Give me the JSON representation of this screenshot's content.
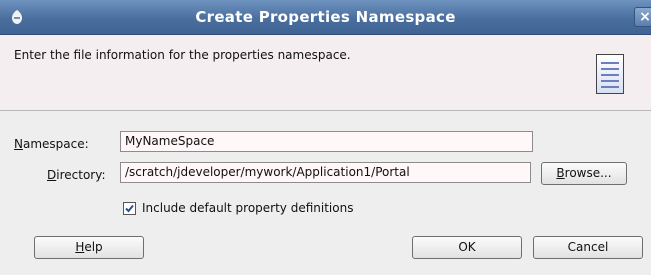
{
  "dialog": {
    "title": "Create Properties Namespace",
    "close_glyph": "×",
    "instructions": "Enter the file information for the properties namespace.",
    "header_icon": "document-icon"
  },
  "form": {
    "namespace_label_mnemonic": "N",
    "namespace_label_rest": "amespace:",
    "namespace_value": "MyNameSpace",
    "directory_label_mnemonic": "D",
    "directory_label_rest": "irectory:",
    "directory_value": "/scratch/jdeveloper/mywork/Application1/Portal",
    "browse_mnemonic": "B",
    "browse_rest": "rowse...",
    "include_defaults_label": "Include default property definitions",
    "include_defaults_checked": true
  },
  "buttons": {
    "help_mnemonic": "H",
    "help_rest": "elp",
    "ok": "OK",
    "cancel": "Cancel"
  },
  "colors": {
    "titlebar": "#4a6f9f",
    "header_panel": "#f4eef0",
    "field_background": "#fff7f8"
  }
}
